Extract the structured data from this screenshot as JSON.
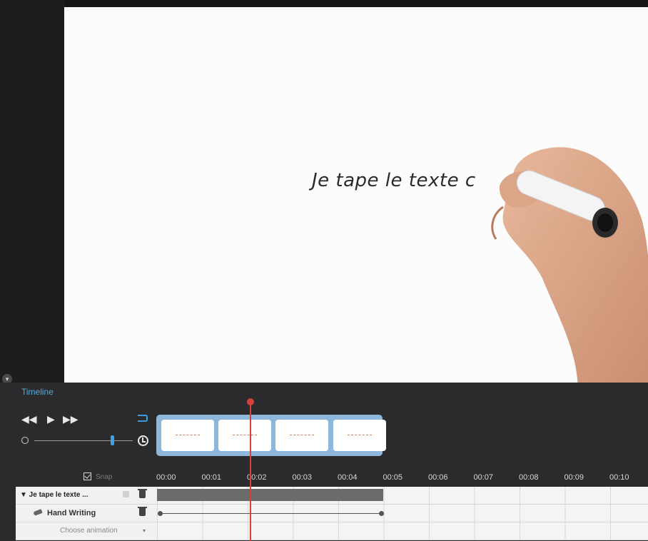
{
  "canvas": {
    "text": "Je tape le texte c"
  },
  "timeline": {
    "title": "Timeline",
    "snap_label": "Snap",
    "ruler": [
      "00:00",
      "00:01",
      "00:02",
      "00:03",
      "00:04",
      "00:05",
      "00:06",
      "00:07",
      "00:08",
      "00:09",
      "00:10"
    ],
    "playhead_time": "00:02",
    "speed_slider_level": 0.8,
    "tracks": [
      {
        "label": "▼ Je tape le texte ...",
        "clip_start": "00:00",
        "clip_end": "00:05"
      },
      {
        "label": "Hand Writing",
        "anim_start": "00:00",
        "anim_end": "00:05"
      },
      {
        "label": "Choose animation",
        "caret": "▾"
      }
    ],
    "controls": {
      "rewind": "◀◀",
      "play": "▶",
      "forward": "▶▶"
    }
  },
  "colors": {
    "accent": "#3ea2e6",
    "playhead": "#d8403a",
    "panel": "#2b2b2d"
  },
  "icons": [
    "rewind-icon",
    "play-icon",
    "fast-forward-icon",
    "loop-icon",
    "speed-slow-icon",
    "speed-fast-icon",
    "snap-checkbox-icon",
    "lock-icon",
    "trash-icon",
    "pen-icon",
    "collapse-icon"
  ]
}
